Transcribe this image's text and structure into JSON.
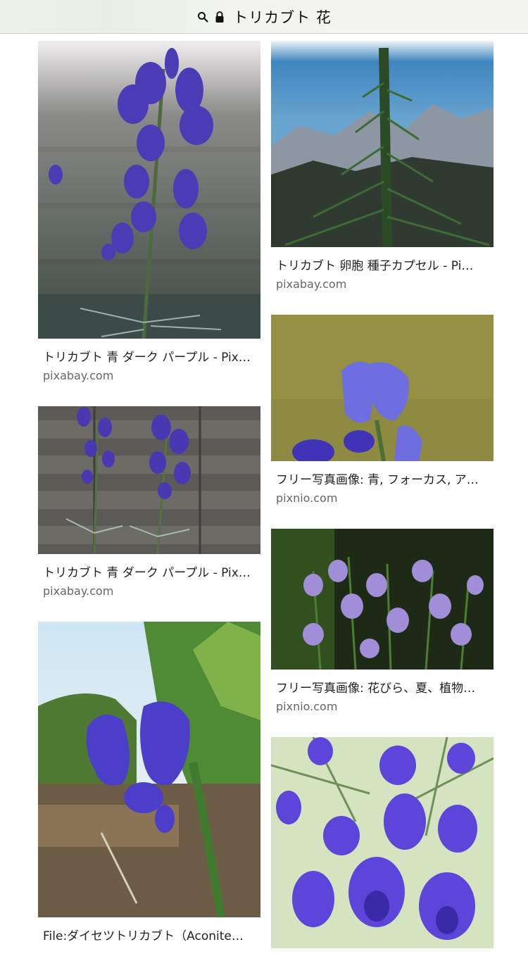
{
  "address_bar": {
    "search_icon": "search-icon",
    "lock_icon": "lock-icon",
    "query": "トリカブト 花"
  },
  "results": {
    "left": [
      {
        "caption": "トリカブト 青 ダーク パープル - Pix…",
        "source": "pixabay.com"
      },
      {
        "caption": "トリカブト 青 ダーク パープル - Pix…",
        "source": "pixabay.com"
      },
      {
        "caption": "File:ダイセツトリカブト（Aconite…",
        "source": ""
      }
    ],
    "right": [
      {
        "caption": "トリカブト 卵胞 種子カプセル - Pi…",
        "source": "pixabay.com"
      },
      {
        "caption": "フリー写真画像: 青, フォーカス, ア…",
        "source": "pixnio.com"
      },
      {
        "caption": "フリー写真画像: 花びら、夏、植物…",
        "source": "pixnio.com"
      },
      {
        "caption": "",
        "source": ""
      }
    ]
  },
  "colors": {
    "flower_purple": "#5a3fc8",
    "caption_text": "#222222",
    "source_text": "#666666"
  }
}
